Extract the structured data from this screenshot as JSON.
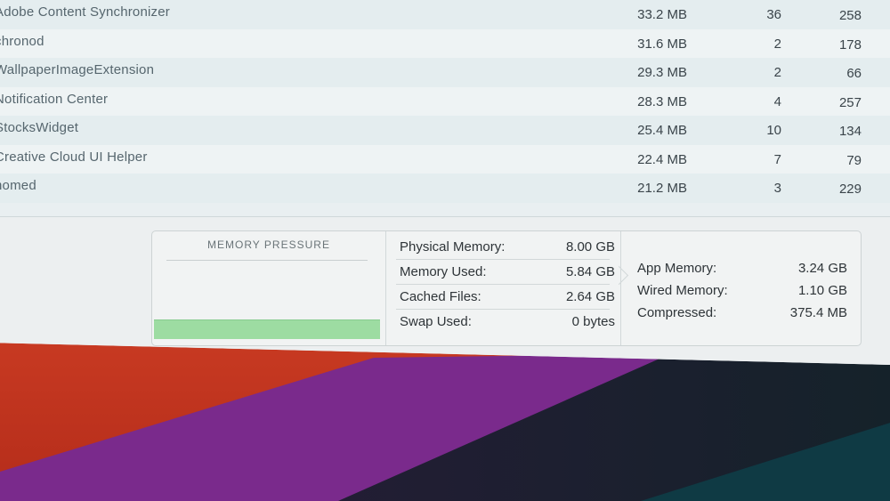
{
  "processes": [
    {
      "name": "Adobe Content Synchronizer",
      "memory": "33.2 MB",
      "threads": "36",
      "ports": "258"
    },
    {
      "name": "chronod",
      "memory": "31.6 MB",
      "threads": "2",
      "ports": "178"
    },
    {
      "name": "WallpaperImageExtension",
      "memory": "29.3 MB",
      "threads": "2",
      "ports": "66"
    },
    {
      "name": "Notification Center",
      "memory": "28.3 MB",
      "threads": "4",
      "ports": "257"
    },
    {
      "name": "StocksWidget",
      "memory": "25.4 MB",
      "threads": "10",
      "ports": "134"
    },
    {
      "name": "Creative Cloud UI Helper",
      "memory": "22.4 MB",
      "threads": "7",
      "ports": "79"
    },
    {
      "name": "nomed",
      "memory": "21.2 MB",
      "threads": "3",
      "ports": "229"
    }
  ],
  "memory_panel": {
    "pressure_title": "MEMORY PRESSURE",
    "pressure_level": 0.14,
    "pressure_color": "#9ddca2",
    "stats": [
      {
        "label": "Physical Memory:",
        "value": "8.00 GB"
      },
      {
        "label": "Memory Used:",
        "value": "5.84 GB"
      },
      {
        "label": "Cached Files:",
        "value": "2.64 GB"
      },
      {
        "label": "Swap Used:",
        "value": "0 bytes"
      }
    ],
    "breakdown": [
      {
        "label": "App Memory:",
        "value": "3.24 GB"
      },
      {
        "label": "Wired Memory:",
        "value": "1.10 GB"
      },
      {
        "label": "Compressed:",
        "value": "375.4 MB"
      }
    ]
  }
}
